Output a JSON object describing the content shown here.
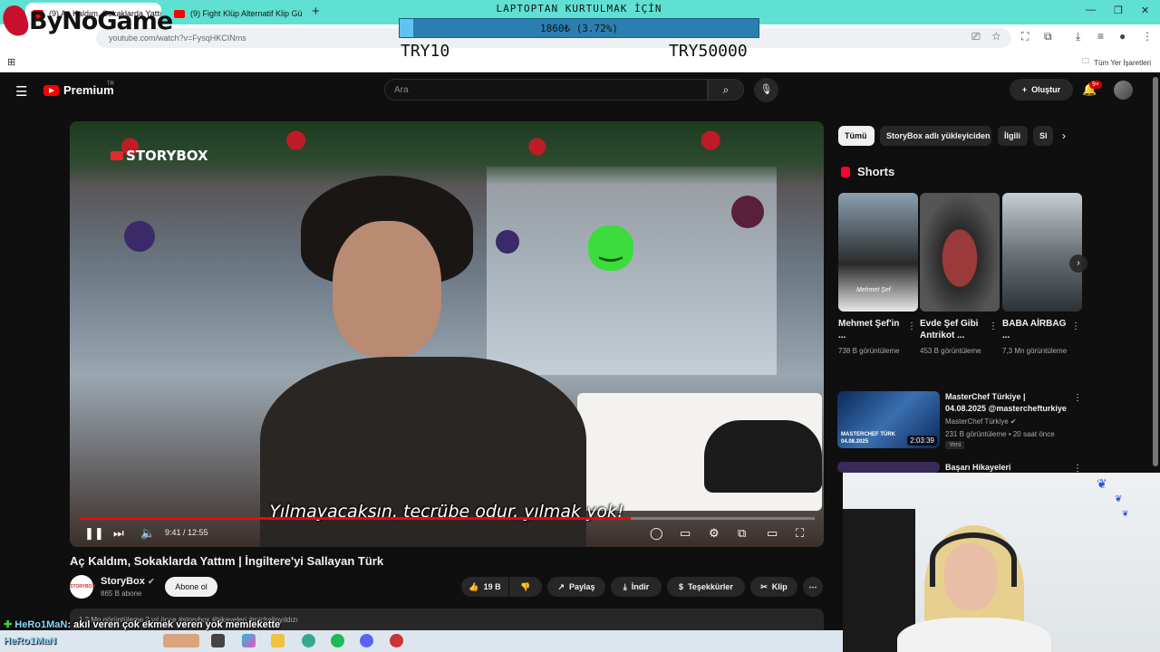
{
  "browser": {
    "tabs": [
      {
        "label": "(9) Aç Kaldım, Sokaklarda Yattı",
        "active": true
      },
      {
        "label": "(9) Fight Klüp Alternatif Klip Gü",
        "active": false
      }
    ],
    "new_tab": "+",
    "url": "youtube.com/watch?v=FysqHKCINms",
    "bookmarks_label": "Tüm Yer İşaretleri"
  },
  "stream_overlay": {
    "brand": "ByNoGame",
    "goal_title": "LAPTOPTAN KURTULMAK İÇİN",
    "goal_progress_text": "1860₺ (3.72%)",
    "goal_percent": 3.72,
    "goal_min": "TRY10",
    "goal_max": "TRY50000"
  },
  "youtube_header": {
    "logo": "Premium",
    "country": "TR",
    "search_placeholder": "Ara",
    "create_label": "Oluştur",
    "notification_count": "9+"
  },
  "player": {
    "watermark": "STORYBOX",
    "subtitle": "Yılmayacaksın, tecrübe odur, yılmak yok!",
    "time": "9:41 / 12:55",
    "progress_fraction": 0.75
  },
  "video": {
    "title": "Aç Kaldım, Sokaklarda Yattım | İngiltere'yi Sallayan Türk",
    "channel": "StoryBox",
    "channel_avatar_text": "STORYBOX",
    "subscribers": "865 B abone",
    "subscribe_label": "Abone ol",
    "likes": "19 B",
    "share_label": "Paylaş",
    "download_label": "İndir",
    "thanks_label": "Teşekkürler",
    "clip_label": "Klip",
    "description_preview": "1,2 Mn görüntüleme  2 yıl önce  #storybox #hikayeleri #michelinyıldızı"
  },
  "sidebar": {
    "chips": [
      "Tümü",
      "StoryBox adlı yükleyiciden",
      "İlgili",
      "Sl"
    ],
    "shorts_heading": "Shorts",
    "shorts": [
      {
        "title": "Mehmet Şef'in ...",
        "views": "738 B görüntüleme",
        "overlay": "Mehmet Şef"
      },
      {
        "title": "Evde Şef Gibi Antrikot ...",
        "views": "453 B görüntüleme"
      },
      {
        "title": "BABA AİRBAG ...",
        "views": "7,3 Mn görüntüleme"
      }
    ],
    "recommendations": [
      {
        "title": "MasterChef Türkiye | 04.08.2025 @masterchefturkiye",
        "channel": "MasterChef Türkiye",
        "meta": "231 B görüntüleme • 20 saat önce",
        "badge": "Yeni",
        "duration": "2:03:39",
        "thumb_caption": "MASTERCHEF TÜRK 04.08.2025"
      },
      {
        "title": "Başarı Hikayeleri",
        "channel": "",
        "meta": "",
        "badge": "",
        "duration": ""
      }
    ]
  },
  "chat": {
    "user1": "HeRo1MaN",
    "message1": "akıl veren çok ekmek veren yok memlekette",
    "user2": "HeRo1MaN"
  },
  "colors": {
    "accent": "#ff0000",
    "tabbar": "#5fe0d3",
    "yt_bg": "#0f0f0f"
  }
}
